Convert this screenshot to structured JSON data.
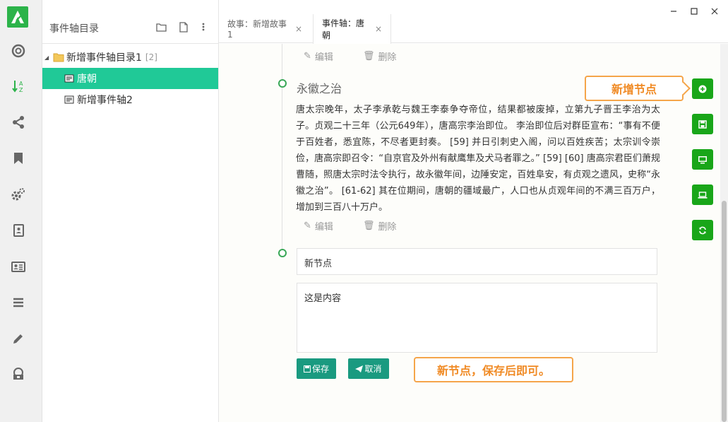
{
  "tree": {
    "title": "事件轴目录",
    "folder": {
      "label": "新增事件轴目录1",
      "count": "[2]"
    },
    "items": [
      {
        "label": "唐朝",
        "selected": true
      },
      {
        "label": "新增事件轴2",
        "selected": false
      }
    ]
  },
  "tabs": [
    {
      "label": "故事：新增故事1",
      "close": "×",
      "active": false
    },
    {
      "label": "事件轴：唐朝",
      "close": "×",
      "active": true
    }
  ],
  "actions": {
    "edit": "编辑",
    "delete": "删除"
  },
  "node": {
    "title": "永徽之治",
    "body": "唐太宗晚年，太子李承乾与魏王李泰争夺帝位，结果都被废掉，立第九子晋王李治为太子。贞观二十三年（公元649年），唐高宗李治即位。 李治即位后对群臣宣布：“事有不便于百姓者，悉宜陈，不尽者更封奏。 [59] 并日引刺史入阁，问以百姓疾苦；太宗训令崇俭，唐高宗即召令：“自京官及外州有献鹰隼及犬马者罪之。” [59] [60] 唐高宗君臣们萧规曹随，照唐太宗时法令执行，故永徽年间，边陲安定，百姓阜安，有贞观之遗风，史称“永徽之治”。 [61-62] 其在位期间，唐朝的疆域最广，人口也从贞观年间的不满三百万户，增加到三百八十万户。"
  },
  "new_node": {
    "title_value": "新节点",
    "content_value": "这是内容",
    "save_label": "保存",
    "cancel_label": "取消"
  },
  "callouts": {
    "add_node": "新增节点",
    "save_hint": "新节点，保存后即可。"
  },
  "colors": {
    "accent": "#20c997",
    "green": "#19a619",
    "teal": "#1a9a80",
    "callout": "#f5a54a"
  }
}
